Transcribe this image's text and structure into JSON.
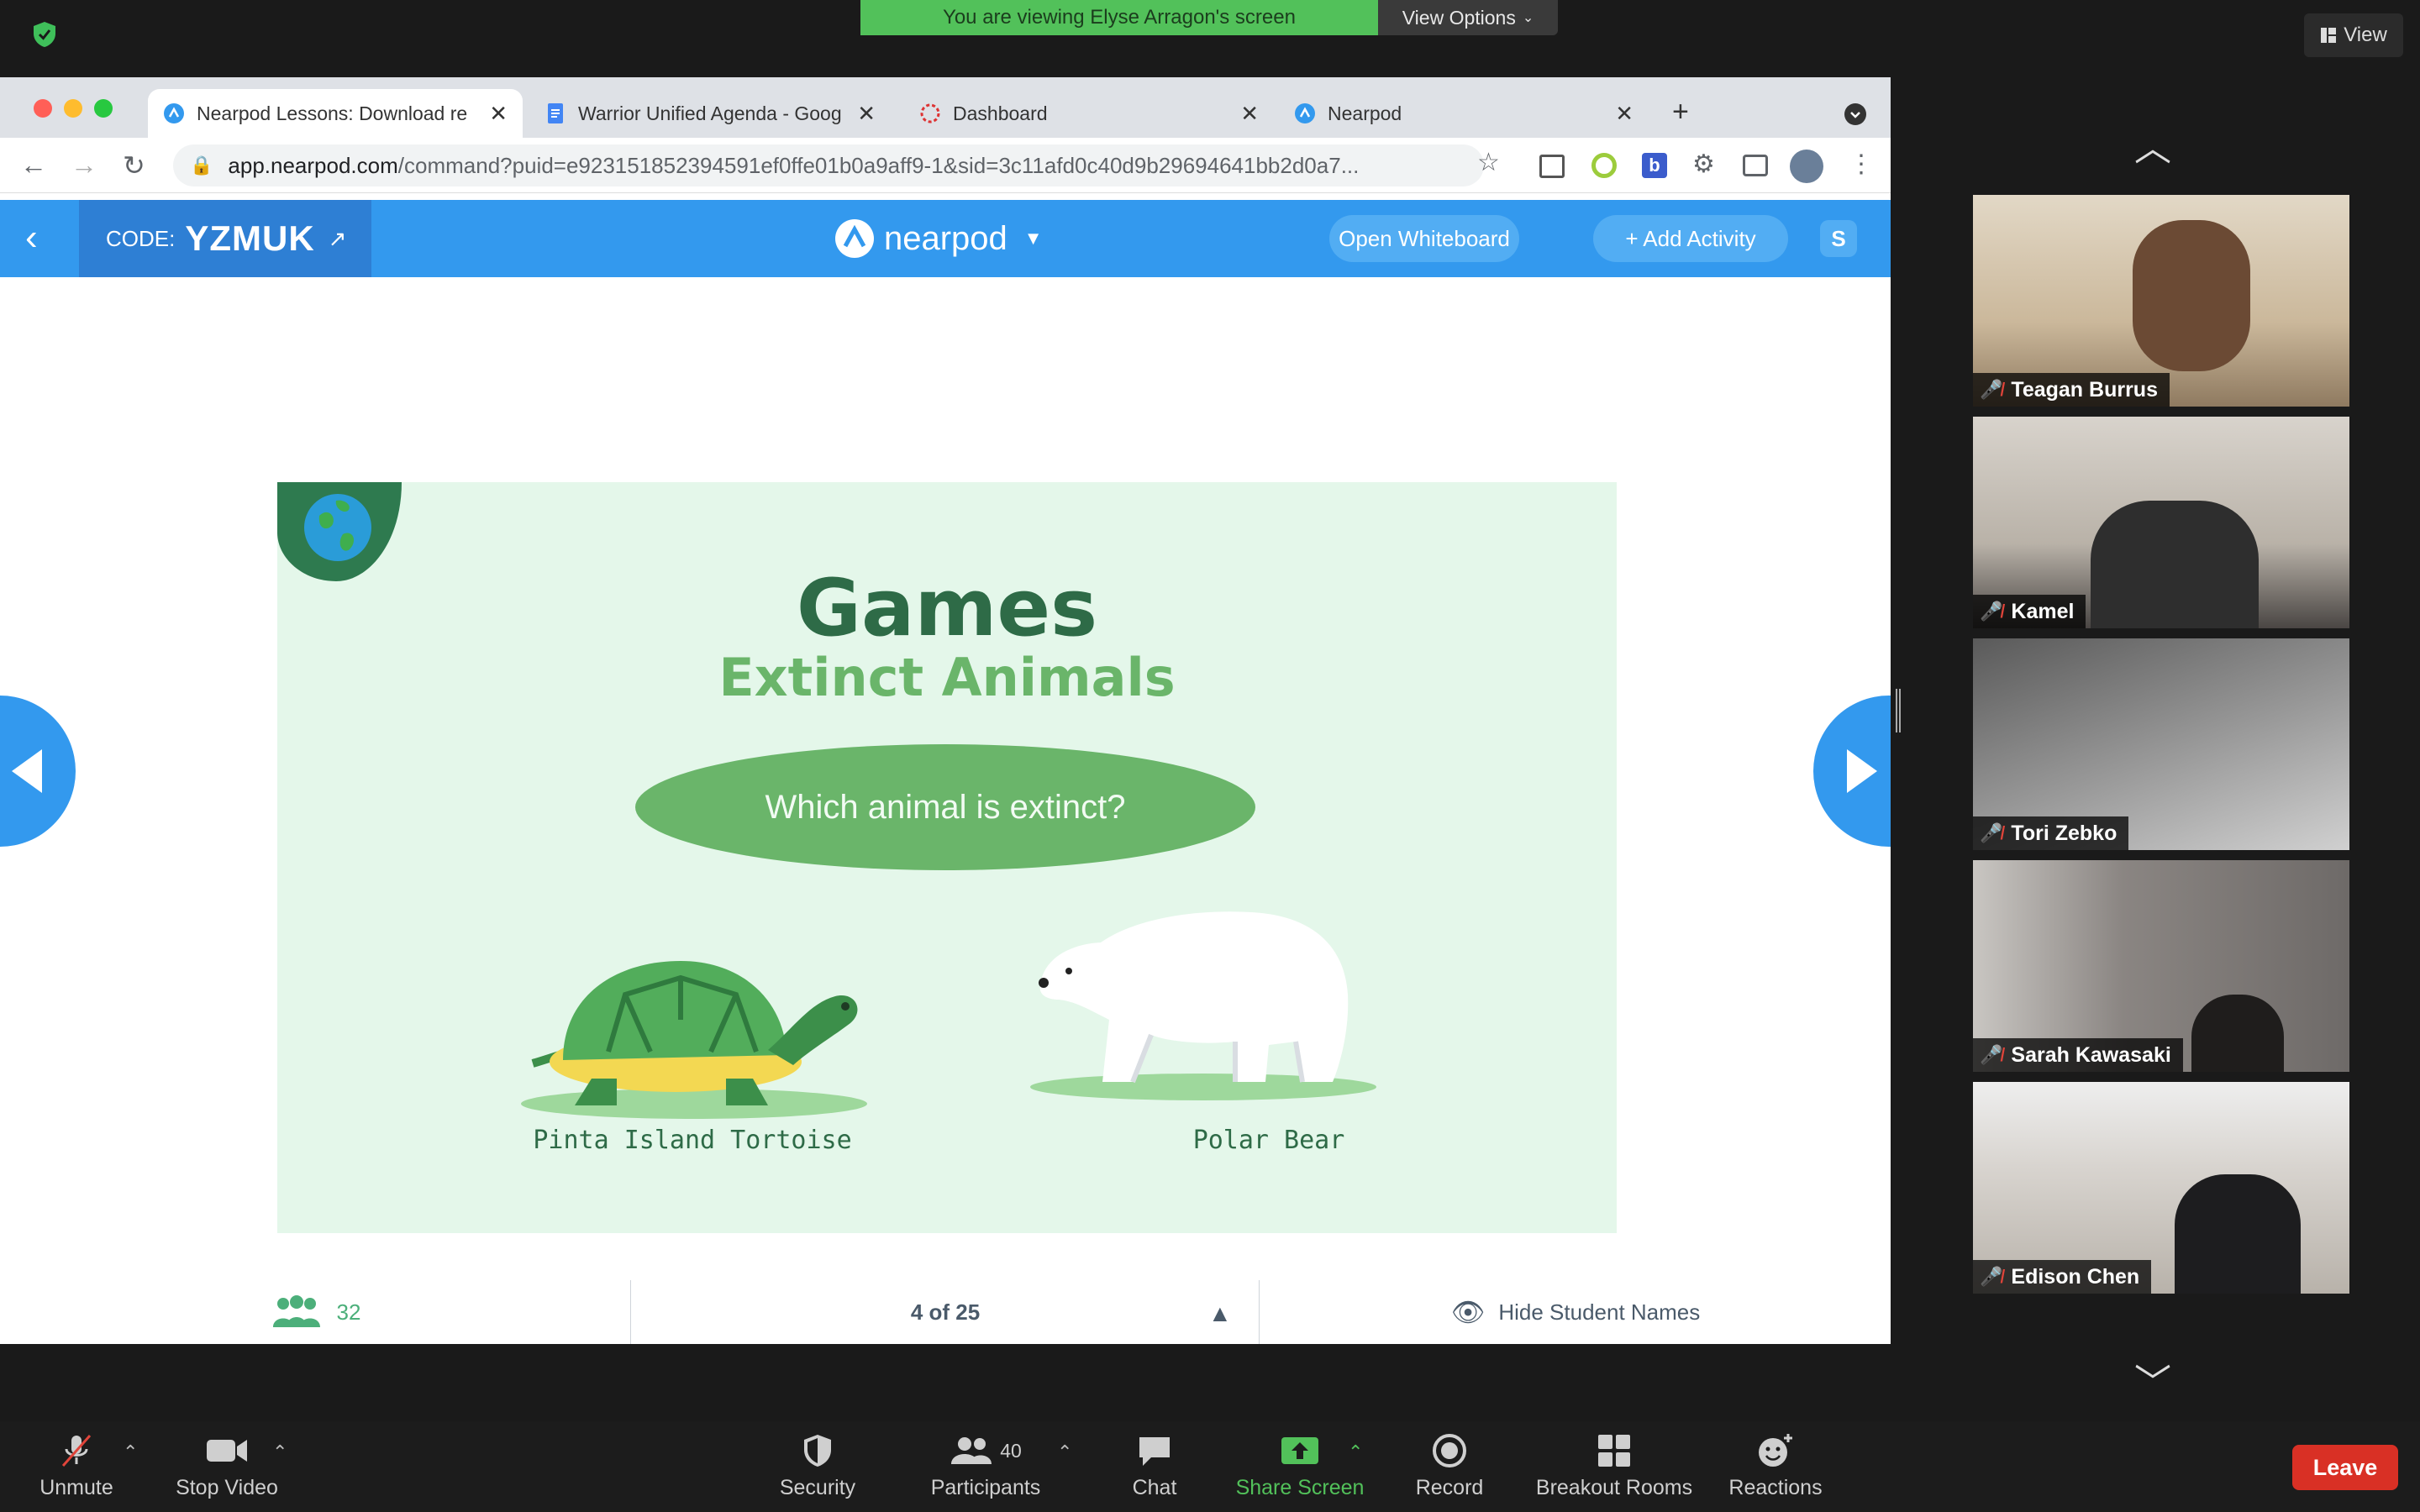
{
  "zoom": {
    "share_banner": "You are viewing Elyse Arragon's screen",
    "view_options": "View Options",
    "view_button": "View",
    "toolbar": {
      "unmute": "Unmute",
      "stop_video": "Stop Video",
      "security": "Security",
      "participants": "Participants",
      "participants_count": "40",
      "chat": "Chat",
      "share_screen": "Share Screen",
      "record": "Record",
      "breakout_rooms": "Breakout Rooms",
      "reactions": "Reactions",
      "leave": "Leave"
    },
    "participants": [
      {
        "name": "Teagan Burrus"
      },
      {
        "name": "Kamel"
      },
      {
        "name": "Tori Zebko"
      },
      {
        "name": "Sarah Kawasaki"
      },
      {
        "name": "Edison Chen"
      }
    ],
    "colors": {
      "share_green": "#52c15a",
      "leave_red": "#d93025",
      "mic_off": "#e0443a"
    }
  },
  "browser": {
    "tabs": [
      {
        "title": "Nearpod Lessons: Download re",
        "icon": "nearpod-icon",
        "active": true
      },
      {
        "title": "Warrior Unified Agenda - Goog",
        "icon": "google-docs-icon",
        "active": false
      },
      {
        "title": "Dashboard",
        "icon": "dashboard-icon",
        "active": false
      },
      {
        "title": "Nearpod",
        "icon": "nearpod-icon",
        "active": false
      }
    ],
    "url_host": "app.nearpod.com",
    "url_path": "/command?puid=e923151852394591ef0ffe01b0a9aff9-1&sid=3c11afd0c40d9b29694641bb2d0a7..."
  },
  "nearpod": {
    "code_label": "CODE:",
    "code_value": "YZMUK",
    "logo_text": "nearpod",
    "open_whiteboard": "Open Whiteboard",
    "add_activity": "+ Add Activity",
    "brand_color": "#3399ee",
    "footer": {
      "student_count": "32",
      "slide_position": "4 of 25",
      "hide_names": "Hide Student Names"
    },
    "slide": {
      "title": "Games",
      "subtitle": "Extinct Animals",
      "question": "Which animal is extinct?",
      "option_1": "Pinta Island Tortoise",
      "option_2": "Polar Bear",
      "bg_color": "#e4f7ea",
      "accent_color": "#6ab56a"
    }
  }
}
